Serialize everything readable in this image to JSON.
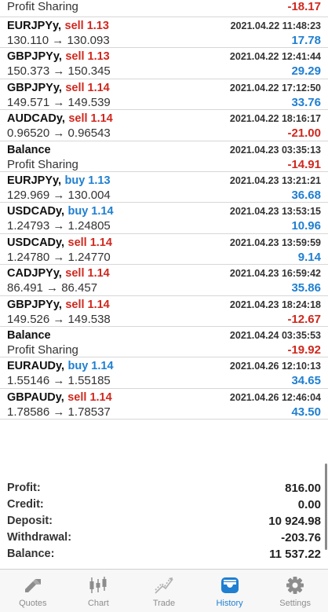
{
  "top_row": {
    "label": "Profit Sharing",
    "value": "-18.17"
  },
  "deals": [
    {
      "symbol": "EURJPYy,",
      "action": "sell 1.13",
      "side": "sell",
      "time": "2021.04.22 11:48:23",
      "prices": "130.110 → 130.093",
      "profit": "17.78",
      "sign": "pos"
    },
    {
      "symbol": "GBPJPYy,",
      "action": "sell 1.13",
      "side": "sell",
      "time": "2021.04.22 12:41:44",
      "prices": "150.373 → 150.345",
      "profit": "29.29",
      "sign": "pos"
    },
    {
      "symbol": "GBPJPYy,",
      "action": "sell 1.14",
      "side": "sell",
      "time": "2021.04.22 17:12:50",
      "prices": "149.571 → 149.539",
      "profit": "33.76",
      "sign": "pos"
    },
    {
      "symbol": "AUDCADy,",
      "action": "sell 1.14",
      "side": "sell",
      "time": "2021.04.22 18:16:17",
      "prices": "0.96520 → 0.96543",
      "profit": "-21.00",
      "sign": "neg"
    },
    {
      "symbol": "Balance",
      "action": "",
      "side": "none",
      "time": "2021.04.23 03:35:13",
      "prices": "Profit Sharing",
      "profit": "-14.91",
      "sign": "neg"
    },
    {
      "symbol": "EURJPYy,",
      "action": "buy 1.13",
      "side": "buy",
      "time": "2021.04.23 13:21:21",
      "prices": "129.969 → 130.004",
      "profit": "36.68",
      "sign": "pos"
    },
    {
      "symbol": "USDCADy,",
      "action": "buy 1.14",
      "side": "buy",
      "time": "2021.04.23 13:53:15",
      "prices": "1.24793 → 1.24805",
      "profit": "10.96",
      "sign": "pos"
    },
    {
      "symbol": "USDCADy,",
      "action": "sell 1.14",
      "side": "sell",
      "time": "2021.04.23 13:59:59",
      "prices": "1.24780 → 1.24770",
      "profit": "9.14",
      "sign": "pos"
    },
    {
      "symbol": "CADJPYy,",
      "action": "sell 1.14",
      "side": "sell",
      "time": "2021.04.23 16:59:42",
      "prices": "86.491 → 86.457",
      "profit": "35.86",
      "sign": "pos"
    },
    {
      "symbol": "GBPJPYy,",
      "action": "sell 1.14",
      "side": "sell",
      "time": "2021.04.23 18:24:18",
      "prices": "149.526 → 149.538",
      "profit": "-12.67",
      "sign": "neg"
    },
    {
      "symbol": "Balance",
      "action": "",
      "side": "none",
      "time": "2021.04.24 03:35:53",
      "prices": "Profit Sharing",
      "profit": "-19.92",
      "sign": "neg"
    },
    {
      "symbol": "EURAUDy,",
      "action": "buy 1.14",
      "side": "buy",
      "time": "2021.04.26 12:10:13",
      "prices": "1.55146 → 1.55185",
      "profit": "34.65",
      "sign": "pos"
    },
    {
      "symbol": "GBPAUDy,",
      "action": "sell 1.14",
      "side": "sell",
      "time": "2021.04.26 12:46:04",
      "prices": "1.78586 → 1.78537",
      "profit": "43.50",
      "sign": "pos"
    }
  ],
  "summary": [
    {
      "label": "Profit:",
      "value": "816.00"
    },
    {
      "label": "Credit:",
      "value": "0.00"
    },
    {
      "label": "Deposit:",
      "value": "10 924.98"
    },
    {
      "label": "Withdrawal:",
      "value": "-203.76"
    },
    {
      "label": "Balance:",
      "value": "11 537.22"
    }
  ],
  "tabs": [
    {
      "label": "Quotes",
      "icon": "quotes-icon",
      "active": false
    },
    {
      "label": "Chart",
      "icon": "chart-icon",
      "active": false
    },
    {
      "label": "Trade",
      "icon": "trade-icon",
      "active": false
    },
    {
      "label": "History",
      "icon": "history-icon",
      "active": true
    },
    {
      "label": "Settings",
      "icon": "settings-icon",
      "active": false
    }
  ],
  "colors": {
    "profit": "#1f7fd1",
    "loss": "#d0281e",
    "active_tab": "#1f7fd1",
    "inactive_tab": "#8d8d8d"
  }
}
